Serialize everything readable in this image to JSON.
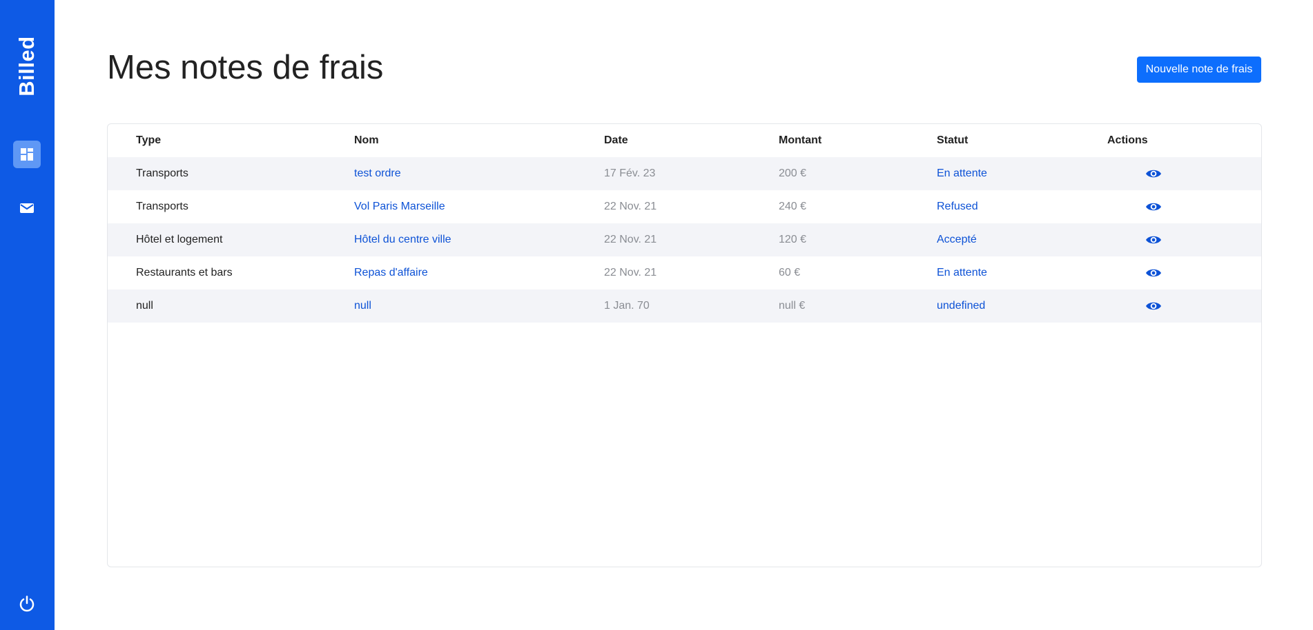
{
  "app": {
    "brand": "Billed"
  },
  "sidebar": {
    "items": [
      {
        "name": "bills",
        "icon": "window-icon"
      },
      {
        "name": "mail",
        "icon": "mail-icon"
      }
    ],
    "logout_icon": "power-icon"
  },
  "page": {
    "title": "Mes notes de frais",
    "new_button": "Nouvelle note de frais"
  },
  "table": {
    "headers": [
      "Type",
      "Nom",
      "Date",
      "Montant",
      "Statut",
      "Actions"
    ],
    "rows": [
      {
        "type": "Transports",
        "name": "test ordre",
        "date": "17 Fév. 23",
        "amount": "200 €",
        "status": "En attente"
      },
      {
        "type": "Transports",
        "name": "Vol Paris Marseille",
        "date": "22 Nov. 21",
        "amount": "240 €",
        "status": "Refused"
      },
      {
        "type": "Hôtel et logement",
        "name": "Hôtel du centre ville",
        "date": "22 Nov. 21",
        "amount": "120 €",
        "status": "Accepté"
      },
      {
        "type": "Restaurants et bars",
        "name": "Repas d'affaire",
        "date": "22 Nov. 21",
        "amount": "60 €",
        "status": "En attente"
      },
      {
        "type": "null",
        "name": "null",
        "date": "1 Jan. 70",
        "amount": "null €",
        "status": "undefined"
      }
    ]
  },
  "colors": {
    "sidebar": "#0e5ae5",
    "active_nav": "#5f98f5",
    "primary_button": "#0d6efd",
    "link_text": "#0d52d6",
    "row_stripe": "#f3f4f8"
  }
}
